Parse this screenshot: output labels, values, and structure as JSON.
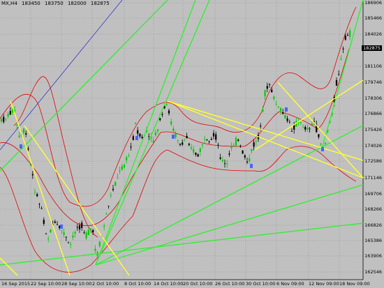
{
  "header": {
    "symbol": "MX,H4",
    "open": "183450",
    "high": "183750",
    "low": "182000",
    "close": "182875"
  },
  "price_axis": {
    "labels": [
      "186906",
      "185466",
      "184026",
      "182875",
      "181106",
      "179746",
      "178306",
      "176866",
      "175426",
      "174026",
      "172586",
      "171146",
      "169706",
      "168266",
      "166826",
      "165386",
      "163906",
      "162546"
    ],
    "current": "182875"
  },
  "time_axis": {
    "labels": [
      "16 Sep 2015",
      "22 Sep 10:00",
      "28 Sep 10:00",
      "2 Oct 10:00",
      "8 Oct 10:00",
      "14 Oct 10:00",
      "20 Oct 10:00",
      "26 Oct 10:00",
      "30 Oct 10:00",
      "6 Nov 09:00",
      "12 Nov 09:00",
      "18 Nov 09:00"
    ]
  },
  "colors": {
    "background": "#c0c0c0",
    "bull_candle": "#00cc00",
    "bear_candle": "#000000",
    "bollinger": "#e00000",
    "trend_yellow": "#ffff33",
    "trend_green": "#33ee33",
    "trend_blue": "#3333cc",
    "fractal": "#4466ff"
  }
}
